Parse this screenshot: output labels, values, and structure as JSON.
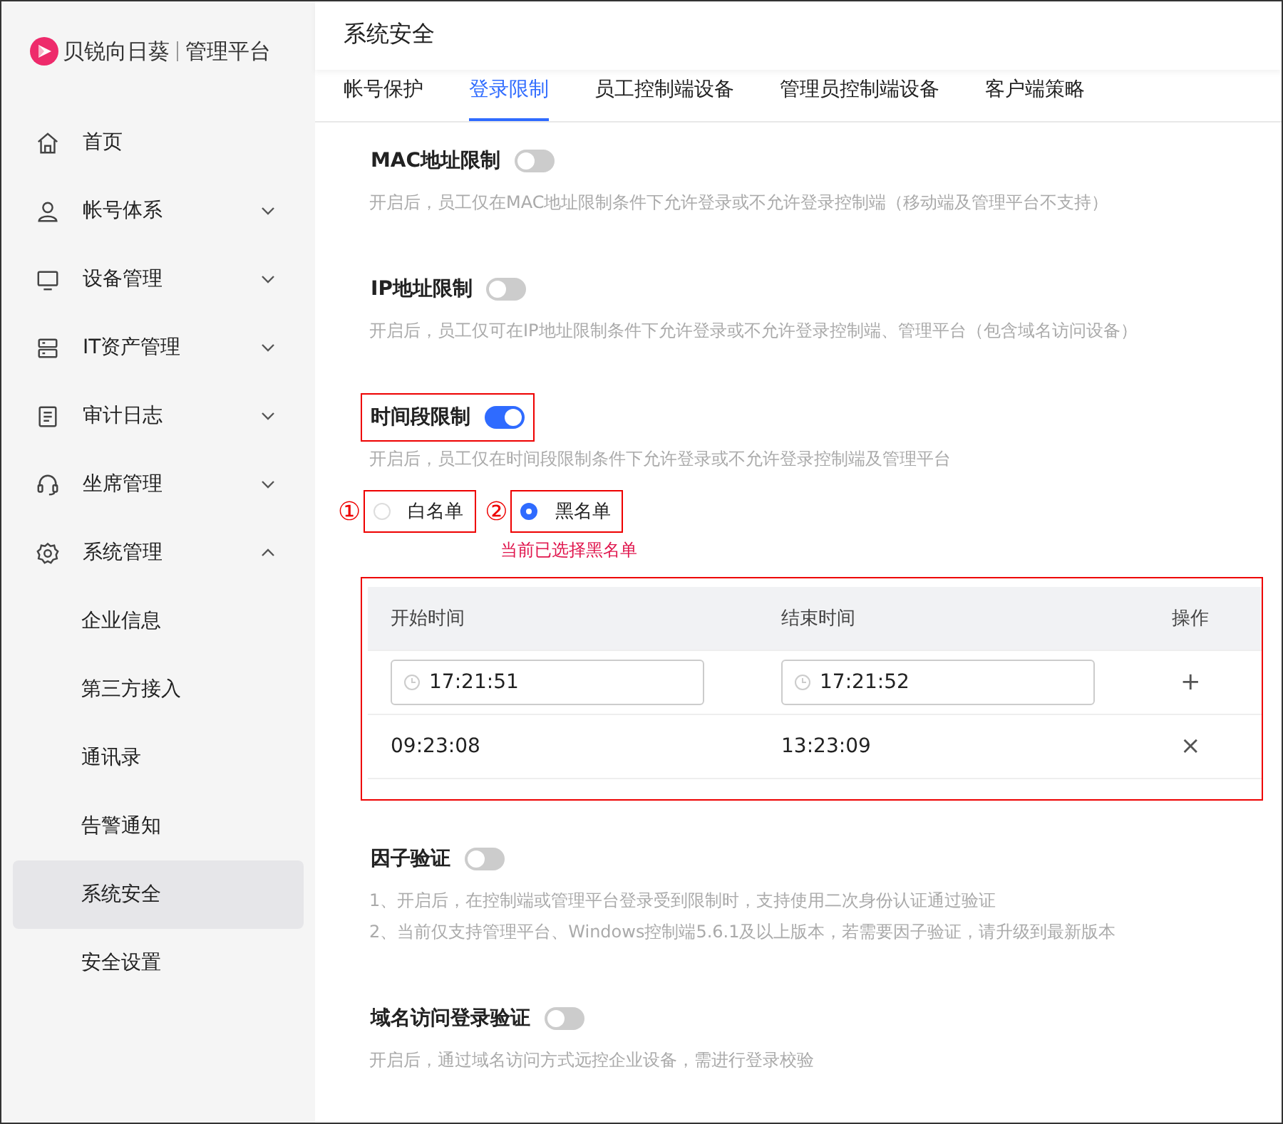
{
  "brand": {
    "name": "贝锐向日葵",
    "product": "管理平台"
  },
  "sidebar": {
    "items": [
      {
        "label": "首页",
        "kind": "link",
        "selected": false
      },
      {
        "label": "帐号体系",
        "kind": "group",
        "expanded": false,
        "selected": false
      },
      {
        "label": "设备管理",
        "kind": "group",
        "expanded": false,
        "selected": false
      },
      {
        "label": "IT资产管理",
        "kind": "group",
        "expanded": false,
        "selected": false
      },
      {
        "label": "审计日志",
        "kind": "group",
        "expanded": false,
        "selected": false
      },
      {
        "label": "坐席管理",
        "kind": "group",
        "expanded": false,
        "selected": false
      },
      {
        "label": "系统管理",
        "kind": "group",
        "expanded": true,
        "selected": false,
        "children": [
          {
            "label": "企业信息",
            "selected": false
          },
          {
            "label": "第三方接入",
            "selected": false
          },
          {
            "label": "通讯录",
            "selected": false
          },
          {
            "label": "告警通知",
            "selected": false
          },
          {
            "label": "系统安全",
            "selected": true
          },
          {
            "label": "安全设置",
            "selected": false
          }
        ]
      }
    ]
  },
  "page_title": "系统安全",
  "tabs": [
    {
      "label": "帐号保护",
      "selected": false
    },
    {
      "label": "登录限制",
      "selected": true
    },
    {
      "label": "员工控制端设备",
      "selected": false
    },
    {
      "label": "管理员控制端设备",
      "selected": false
    },
    {
      "label": "客户端策略",
      "selected": false
    }
  ],
  "settings": [
    {
      "title": "MAC地址限制",
      "on": false,
      "annotated": false,
      "description": [
        "开启后，员工仅在MAC地址限制条件下允许登录或不允许登录控制端（移动端及管理平台不支持）"
      ]
    },
    {
      "title": "IP地址限制",
      "on": false,
      "annotated": false,
      "description": [
        "开启后，员工仅可在IP地址限制条件下允许登录或不允许登录控制端、管理平台（包含域名访问设备）"
      ]
    },
    {
      "title": "时间段限制",
      "on": true,
      "annotated": true,
      "description": [
        "开启后，员工仅在时间段限制条件下允许登录或不允许登录控制端及管理平台"
      ],
      "options": [
        {
          "marker": "①",
          "label": "白名单",
          "selected": false
        },
        {
          "marker": "②",
          "label": "黑名单",
          "selected": true
        }
      ],
      "note": "当前已选择黑名单",
      "table": {
        "annotated": true,
        "columns": [
          "开始时间",
          "结束时间",
          "操作"
        ],
        "input_row": {
          "start": "17:21:51",
          "end": "17:21:52",
          "action": "+"
        },
        "rows": [
          {
            "start": "09:23:08",
            "end": "13:23:09",
            "action": "×"
          }
        ]
      }
    },
    {
      "title": "因子验证",
      "on": false,
      "annotated": false,
      "description": [
        "1、开启后，在控制端或管理平台登录受到限制时，支持使用二次身份认证通过验证",
        "2、当前仅支持管理平台、Windows控制端5.6.1及以上版本，若需要因子验证，请升级到最新版本"
      ]
    },
    {
      "title": "域名访问登录验证",
      "on": false,
      "annotated": false,
      "description": [
        "开启后，通过域名访问方式远控企业设备，需进行登录校验"
      ]
    }
  ]
}
